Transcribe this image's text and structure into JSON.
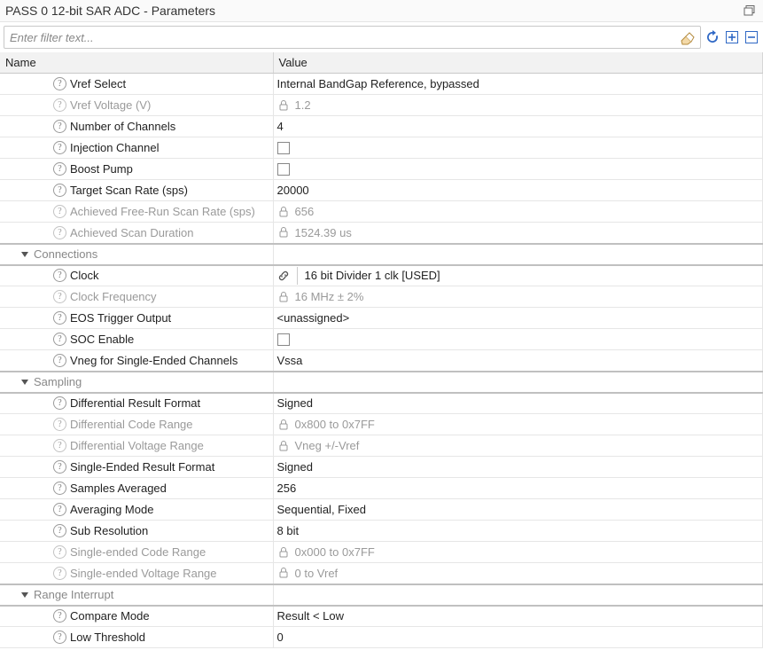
{
  "header": {
    "title": "PASS 0 12-bit SAR ADC - Parameters"
  },
  "filter": {
    "placeholder": "Enter filter text..."
  },
  "columns": {
    "name": "Name",
    "value": "Value"
  },
  "rows": [
    {
      "kind": "param",
      "label": "Vref Select",
      "value": "Internal BandGap Reference, bypassed",
      "readonly": false,
      "strong": false
    },
    {
      "kind": "param",
      "label": "Vref Voltage (V)",
      "value": "1.2",
      "readonly": true,
      "strong": false
    },
    {
      "kind": "param",
      "label": "Number of Channels",
      "value": "4",
      "readonly": false,
      "strong": false
    },
    {
      "kind": "param",
      "label": "Injection Channel",
      "value": "",
      "readonly": false,
      "checkbox": true,
      "strong": false
    },
    {
      "kind": "param",
      "label": "Boost Pump",
      "value": "",
      "readonly": false,
      "checkbox": true,
      "strong": false
    },
    {
      "kind": "param",
      "label": "Target Scan Rate (sps)",
      "value": "20000",
      "readonly": false,
      "strong": false
    },
    {
      "kind": "param",
      "label": "Achieved Free-Run Scan Rate (sps)",
      "value": "656",
      "readonly": true,
      "strong": false
    },
    {
      "kind": "param",
      "label": "Achieved Scan Duration",
      "value": "1524.39 us",
      "readonly": true,
      "strong": true
    },
    {
      "kind": "group",
      "label": "Connections"
    },
    {
      "kind": "param",
      "label": "Clock",
      "value": "16 bit Divider 1 clk [USED]",
      "readonly": false,
      "link": true,
      "strong": false
    },
    {
      "kind": "param",
      "label": "Clock Frequency",
      "value": "16 MHz ± 2%",
      "readonly": true,
      "strong": false
    },
    {
      "kind": "param",
      "label": "EOS Trigger Output",
      "value": "<unassigned>",
      "readonly": false,
      "strong": false
    },
    {
      "kind": "param",
      "label": "SOC Enable",
      "value": "",
      "readonly": false,
      "checkbox": true,
      "strong": false
    },
    {
      "kind": "param",
      "label": "Vneg for Single-Ended Channels",
      "value": "Vssa",
      "readonly": false,
      "strong": true
    },
    {
      "kind": "group",
      "label": "Sampling"
    },
    {
      "kind": "param",
      "label": "Differential Result Format",
      "value": "Signed",
      "readonly": false,
      "strong": false
    },
    {
      "kind": "param",
      "label": "Differential Code Range",
      "value": "0x800 to 0x7FF",
      "readonly": true,
      "strong": false
    },
    {
      "kind": "param",
      "label": "Differential Voltage Range",
      "value": "Vneg +/-Vref",
      "readonly": true,
      "strong": false
    },
    {
      "kind": "param",
      "label": "Single-Ended Result Format",
      "value": "Signed",
      "readonly": false,
      "strong": false
    },
    {
      "kind": "param",
      "label": "Samples Averaged",
      "value": "256",
      "readonly": false,
      "strong": false
    },
    {
      "kind": "param",
      "label": "Averaging Mode",
      "value": "Sequential, Fixed",
      "readonly": false,
      "strong": false
    },
    {
      "kind": "param",
      "label": "Sub Resolution",
      "value": "8 bit",
      "readonly": false,
      "strong": false
    },
    {
      "kind": "param",
      "label": "Single-ended Code Range",
      "value": "0x000 to 0x7FF",
      "readonly": true,
      "strong": false
    },
    {
      "kind": "param",
      "label": "Single-ended Voltage Range",
      "value": "0 to Vref",
      "readonly": true,
      "strong": true
    },
    {
      "kind": "group",
      "label": "Range Interrupt"
    },
    {
      "kind": "param",
      "label": "Compare Mode",
      "value": "Result < Low",
      "readonly": false,
      "strong": false
    },
    {
      "kind": "param",
      "label": "Low Threshold",
      "value": "0",
      "readonly": false,
      "strong": false
    }
  ]
}
